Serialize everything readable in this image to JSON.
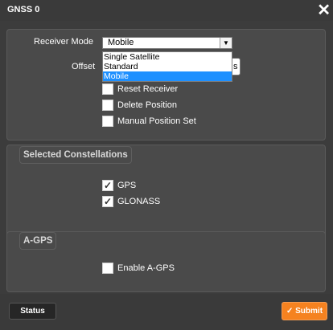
{
  "dialog": {
    "title": "GNSS 0",
    "close_glyph": "✕"
  },
  "receiver": {
    "mode_label": "Receiver Mode",
    "mode_value": "Mobile",
    "mode_options": [
      "Single Satellite",
      "Standard",
      "Mobile"
    ],
    "selected_option_index": 2,
    "offset_label": "Offset",
    "offset_tail_text": "s"
  },
  "actions": {
    "reset_receiver": {
      "label": "Reset Receiver",
      "checked": false
    },
    "delete_position": {
      "label": "Delete Position",
      "checked": false
    },
    "manual_position_set": {
      "label": "Manual Position Set",
      "checked": false
    }
  },
  "constellations": {
    "title": "Selected Constellations",
    "gps": {
      "label": "GPS",
      "checked": true
    },
    "glonass": {
      "label": "GLONASS",
      "checked": true
    }
  },
  "agps": {
    "title": "A-GPS",
    "enable": {
      "label": "Enable A-GPS",
      "checked": false
    }
  },
  "footer": {
    "status_label": "Status",
    "submit_label": "Submit",
    "submit_icon": "checkmark-icon"
  },
  "colors": {
    "background": "#3c3c3c",
    "panel": "#4a4a4a",
    "submit": "#f58220",
    "selected_option": "#1e90ff"
  }
}
